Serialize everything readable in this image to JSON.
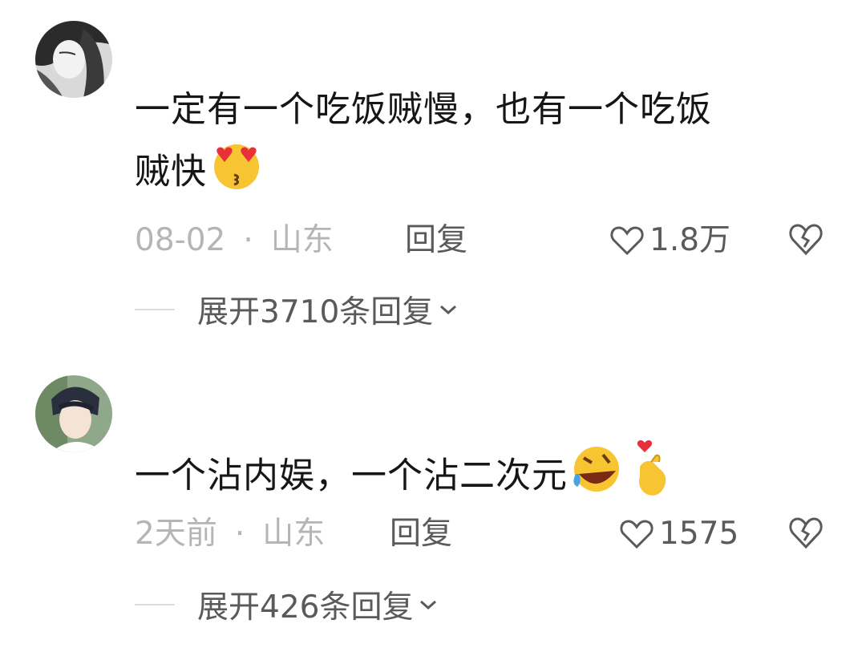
{
  "comments": [
    {
      "text_line1": "一定有一个吃饭贼慢，也有一个吃饭",
      "text_line2": "贼快",
      "emoji": [
        "smiling-face-with-heart-eyes-kiss"
      ],
      "date": "08-02",
      "separator": "·",
      "location": "山东",
      "reply_label": "回复",
      "likes": "1.8万",
      "expand_label": "展开3710条回复"
    },
    {
      "text_line1": "一个沾内娱，一个沾二次元",
      "emoji": [
        "rolling-on-floor-laughing",
        "heart-hands"
      ],
      "date": "2天前",
      "separator": "·",
      "location": "山东",
      "reply_label": "回复",
      "likes": "1575",
      "expand_label": "展开426条回复"
    }
  ]
}
